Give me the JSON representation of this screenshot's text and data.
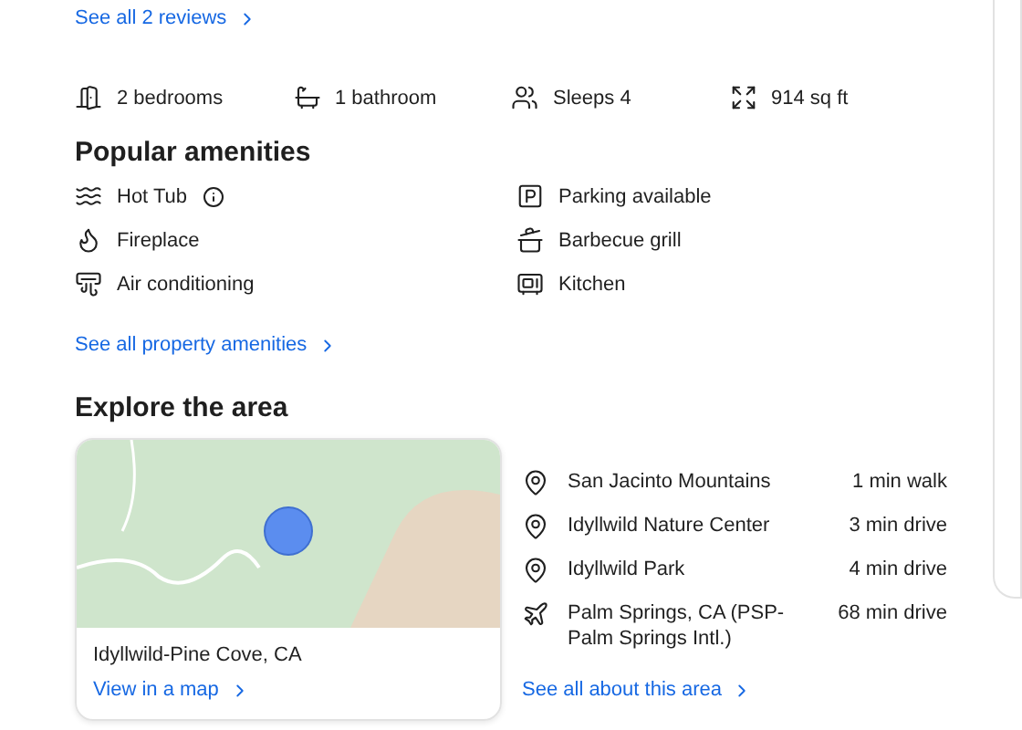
{
  "reviews_link": "See all 2 reviews",
  "facts": [
    "2 bedrooms",
    "1 bathroom",
    "Sleeps 4",
    "914 sq ft"
  ],
  "amenities": {
    "title": "Popular amenities",
    "items": [
      {
        "label": "Hot Tub",
        "info": true
      },
      {
        "label": "Parking available",
        "info": false
      },
      {
        "label": "Fireplace",
        "info": false
      },
      {
        "label": "Barbecue grill",
        "info": false
      },
      {
        "label": "Air conditioning",
        "info": false
      },
      {
        "label": "Kitchen",
        "info": false
      }
    ],
    "link": "See all property amenities"
  },
  "area": {
    "title": "Explore the area",
    "map_card": {
      "place": "Idyllwild-Pine Cove, CA",
      "link": "View in a map"
    },
    "places": [
      {
        "kind": "pin",
        "name": "San Jacinto Mountains",
        "distance": "1 min walk"
      },
      {
        "kind": "pin",
        "name": "Idyllwild Nature Center",
        "distance": "3 min drive"
      },
      {
        "kind": "pin",
        "name": "Idyllwild Park",
        "distance": "4 min drive"
      },
      {
        "kind": "airport",
        "name": "Palm Springs, CA (PSP-Palm Springs Intl.)",
        "distance": "68 min drive"
      }
    ],
    "link": "See all about this area"
  }
}
